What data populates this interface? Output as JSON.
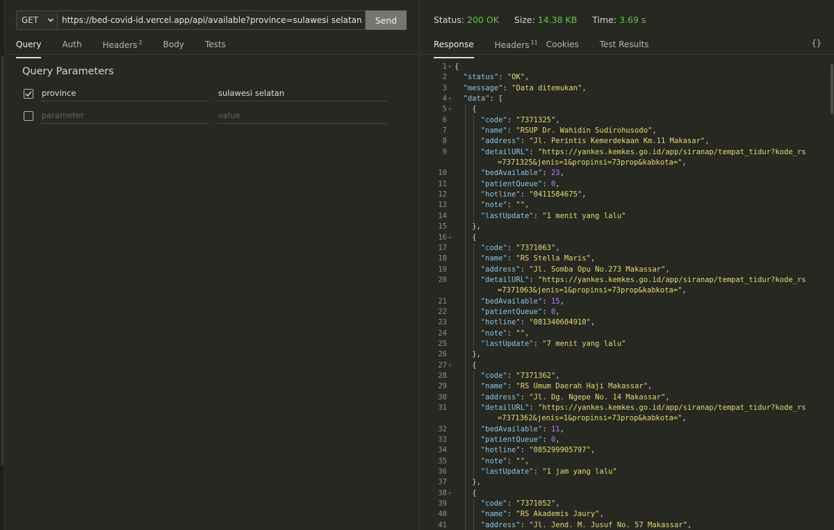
{
  "request": {
    "method": "GET",
    "url": "https://bed-covid-id.vercel.app/api/available?province=sulawesi selatan",
    "send_label": "Send"
  },
  "request_tabs": [
    {
      "label": "Query",
      "active": true
    },
    {
      "label": "Auth"
    },
    {
      "label": "Headers",
      "badge": "2"
    },
    {
      "label": "Body"
    },
    {
      "label": "Tests"
    }
  ],
  "query": {
    "title": "Query Parameters",
    "params": [
      {
        "checked": true,
        "name": "province",
        "value": "sulawesi selatan"
      }
    ],
    "new_param": {
      "name_placeholder": "parameter",
      "value_placeholder": "value"
    }
  },
  "response": {
    "status_label": "Status:",
    "status_value": "200 OK",
    "size_label": "Size:",
    "size_value": "14.38 KB",
    "time_label": "Time:",
    "time_value": "3.69 s",
    "tabs": [
      {
        "label": "Response",
        "active": true
      },
      {
        "label": "Headers",
        "badge": "11"
      },
      {
        "label": "Cookies"
      },
      {
        "label": "Test Results"
      }
    ],
    "braces": "{}"
  },
  "colors": {
    "background": "#272822",
    "status_ok": "#62c54b",
    "json_key": "#8fc4e6",
    "json_string": "#e6db74",
    "json_number": "#ae81ff"
  },
  "code_lines": [
    {
      "n": "1",
      "fold": true,
      "indent": 0,
      "t": [
        [
          "p",
          "{"
        ]
      ]
    },
    {
      "n": "2",
      "indent": 1,
      "t": [
        [
          "k",
          "\"status\""
        ],
        [
          "p",
          ": "
        ],
        [
          "s",
          "\"OK\""
        ],
        [
          "p",
          ","
        ]
      ]
    },
    {
      "n": "3",
      "indent": 1,
      "t": [
        [
          "k",
          "\"message\""
        ],
        [
          "p",
          ": "
        ],
        [
          "s",
          "\"Data ditemukan\""
        ],
        [
          "p",
          ","
        ]
      ]
    },
    {
      "n": "4",
      "fold": true,
      "indent": 1,
      "t": [
        [
          "k",
          "\"data\""
        ],
        [
          "p",
          ": ["
        ]
      ]
    },
    {
      "n": "5",
      "fold": true,
      "indent": 2,
      "t": [
        [
          "p",
          "{"
        ]
      ]
    },
    {
      "n": "6",
      "indent": 3,
      "t": [
        [
          "k",
          "\"code\""
        ],
        [
          "p",
          ": "
        ],
        [
          "s",
          "\"7371325\""
        ],
        [
          "p",
          ","
        ]
      ]
    },
    {
      "n": "7",
      "indent": 3,
      "t": [
        [
          "k",
          "\"name\""
        ],
        [
          "p",
          ": "
        ],
        [
          "s",
          "\"RSUP Dr. Wahidin Sudirohusodo\""
        ],
        [
          "p",
          ","
        ]
      ]
    },
    {
      "n": "8",
      "indent": 3,
      "t": [
        [
          "k",
          "\"address\""
        ],
        [
          "p",
          ": "
        ],
        [
          "s",
          "\"Jl. Perintis Kemerdekaan Km.11 Makasar\""
        ],
        [
          "p",
          ","
        ]
      ]
    },
    {
      "n": "9",
      "indent": 3,
      "t": [
        [
          "k",
          "\"detailURL\""
        ],
        [
          "p",
          ": "
        ],
        [
          "s",
          "\"https://yankes.kemkes.go.id/app/siranap/tempat_tidur?kode_rs"
        ]
      ]
    },
    {
      "n": "",
      "indent": 3,
      "wrap": true,
      "t": [
        [
          "s",
          "=7371325&jenis=1&propinsi=73prop&kabkota=\""
        ],
        [
          "p",
          ","
        ]
      ]
    },
    {
      "n": "10",
      "indent": 3,
      "t": [
        [
          "k",
          "\"bedAvailable\""
        ],
        [
          "p",
          ": "
        ],
        [
          "n",
          "23"
        ],
        [
          "p",
          ","
        ]
      ]
    },
    {
      "n": "11",
      "indent": 3,
      "t": [
        [
          "k",
          "\"patientQueue\""
        ],
        [
          "p",
          ": "
        ],
        [
          "n",
          "0"
        ],
        [
          "p",
          ","
        ]
      ]
    },
    {
      "n": "12",
      "indent": 3,
      "t": [
        [
          "k",
          "\"hotline\""
        ],
        [
          "p",
          ": "
        ],
        [
          "s",
          "\"0411584675\""
        ],
        [
          "p",
          ","
        ]
      ]
    },
    {
      "n": "13",
      "indent": 3,
      "t": [
        [
          "k",
          "\"note\""
        ],
        [
          "p",
          ": "
        ],
        [
          "s",
          "\"\""
        ],
        [
          "p",
          ","
        ]
      ]
    },
    {
      "n": "14",
      "indent": 3,
      "t": [
        [
          "k",
          "\"lastUpdate\""
        ],
        [
          "p",
          ": "
        ],
        [
          "s",
          "\"1 menit yang lalu\""
        ]
      ]
    },
    {
      "n": "15",
      "indent": 2,
      "t": [
        [
          "p",
          "},"
        ]
      ]
    },
    {
      "n": "16",
      "fold": true,
      "indent": 2,
      "t": [
        [
          "p",
          "{"
        ]
      ]
    },
    {
      "n": "17",
      "indent": 3,
      "t": [
        [
          "k",
          "\"code\""
        ],
        [
          "p",
          ": "
        ],
        [
          "s",
          "\"7371063\""
        ],
        [
          "p",
          ","
        ]
      ]
    },
    {
      "n": "18",
      "indent": 3,
      "t": [
        [
          "k",
          "\"name\""
        ],
        [
          "p",
          ": "
        ],
        [
          "s",
          "\"RS Stella Maris\""
        ],
        [
          "p",
          ","
        ]
      ]
    },
    {
      "n": "19",
      "indent": 3,
      "t": [
        [
          "k",
          "\"address\""
        ],
        [
          "p",
          ": "
        ],
        [
          "s",
          "\"Jl. Somba Opu No.273 Makassar\""
        ],
        [
          "p",
          ","
        ]
      ]
    },
    {
      "n": "20",
      "indent": 3,
      "t": [
        [
          "k",
          "\"detailURL\""
        ],
        [
          "p",
          ": "
        ],
        [
          "s",
          "\"https://yankes.kemkes.go.id/app/siranap/tempat_tidur?kode_rs"
        ]
      ]
    },
    {
      "n": "",
      "indent": 3,
      "wrap": true,
      "t": [
        [
          "s",
          "=7371063&jenis=1&propinsi=73prop&kabkota=\""
        ],
        [
          "p",
          ","
        ]
      ]
    },
    {
      "n": "21",
      "indent": 3,
      "t": [
        [
          "k",
          "\"bedAvailable\""
        ],
        [
          "p",
          ": "
        ],
        [
          "n",
          "15"
        ],
        [
          "p",
          ","
        ]
      ]
    },
    {
      "n": "22",
      "indent": 3,
      "t": [
        [
          "k",
          "\"patientQueue\""
        ],
        [
          "p",
          ": "
        ],
        [
          "n",
          "0"
        ],
        [
          "p",
          ","
        ]
      ]
    },
    {
      "n": "23",
      "indent": 3,
      "t": [
        [
          "k",
          "\"hotline\""
        ],
        [
          "p",
          ": "
        ],
        [
          "s",
          "\"081340604910\""
        ],
        [
          "p",
          ","
        ]
      ]
    },
    {
      "n": "24",
      "indent": 3,
      "t": [
        [
          "k",
          "\"note\""
        ],
        [
          "p",
          ": "
        ],
        [
          "s",
          "\"\""
        ],
        [
          "p",
          ","
        ]
      ]
    },
    {
      "n": "25",
      "indent": 3,
      "t": [
        [
          "k",
          "\"lastUpdate\""
        ],
        [
          "p",
          ": "
        ],
        [
          "s",
          "\"7 menit yang lalu\""
        ]
      ]
    },
    {
      "n": "26",
      "indent": 2,
      "t": [
        [
          "p",
          "},"
        ]
      ]
    },
    {
      "n": "27",
      "fold": true,
      "indent": 2,
      "t": [
        [
          "p",
          "{"
        ]
      ]
    },
    {
      "n": "28",
      "indent": 3,
      "t": [
        [
          "k",
          "\"code\""
        ],
        [
          "p",
          ": "
        ],
        [
          "s",
          "\"7371362\""
        ],
        [
          "p",
          ","
        ]
      ]
    },
    {
      "n": "29",
      "indent": 3,
      "t": [
        [
          "k",
          "\"name\""
        ],
        [
          "p",
          ": "
        ],
        [
          "s",
          "\"RS Umum Daerah Haji Makassar\""
        ],
        [
          "p",
          ","
        ]
      ]
    },
    {
      "n": "30",
      "indent": 3,
      "t": [
        [
          "k",
          "\"address\""
        ],
        [
          "p",
          ": "
        ],
        [
          "s",
          "\"Jl. Dg. Ngepe No. 14 Makassar\""
        ],
        [
          "p",
          ","
        ]
      ]
    },
    {
      "n": "31",
      "indent": 3,
      "t": [
        [
          "k",
          "\"detailURL\""
        ],
        [
          "p",
          ": "
        ],
        [
          "s",
          "\"https://yankes.kemkes.go.id/app/siranap/tempat_tidur?kode_rs"
        ]
      ]
    },
    {
      "n": "",
      "indent": 3,
      "wrap": true,
      "t": [
        [
          "s",
          "=7371362&jenis=1&propinsi=73prop&kabkota=\""
        ],
        [
          "p",
          ","
        ]
      ]
    },
    {
      "n": "32",
      "indent": 3,
      "t": [
        [
          "k",
          "\"bedAvailable\""
        ],
        [
          "p",
          ": "
        ],
        [
          "n",
          "11"
        ],
        [
          "p",
          ","
        ]
      ]
    },
    {
      "n": "33",
      "indent": 3,
      "t": [
        [
          "k",
          "\"patientQueue\""
        ],
        [
          "p",
          ": "
        ],
        [
          "n",
          "0"
        ],
        [
          "p",
          ","
        ]
      ]
    },
    {
      "n": "34",
      "indent": 3,
      "t": [
        [
          "k",
          "\"hotline\""
        ],
        [
          "p",
          ": "
        ],
        [
          "s",
          "\"085299905797\""
        ],
        [
          "p",
          ","
        ]
      ]
    },
    {
      "n": "35",
      "indent": 3,
      "t": [
        [
          "k",
          "\"note\""
        ],
        [
          "p",
          ": "
        ],
        [
          "s",
          "\"\""
        ],
        [
          "p",
          ","
        ]
      ]
    },
    {
      "n": "36",
      "indent": 3,
      "t": [
        [
          "k",
          "\"lastUpdate\""
        ],
        [
          "p",
          ": "
        ],
        [
          "s",
          "\"1 jam yang lalu\""
        ]
      ]
    },
    {
      "n": "37",
      "indent": 2,
      "t": [
        [
          "p",
          "},"
        ]
      ]
    },
    {
      "n": "38",
      "fold": true,
      "indent": 2,
      "t": [
        [
          "p",
          "{"
        ]
      ]
    },
    {
      "n": "39",
      "indent": 3,
      "t": [
        [
          "k",
          "\"code\""
        ],
        [
          "p",
          ": "
        ],
        [
          "s",
          "\"7371052\""
        ],
        [
          "p",
          ","
        ]
      ]
    },
    {
      "n": "40",
      "indent": 3,
      "t": [
        [
          "k",
          "\"name\""
        ],
        [
          "p",
          ": "
        ],
        [
          "s",
          "\"RS Akademis Jaury\""
        ],
        [
          "p",
          ","
        ]
      ]
    },
    {
      "n": "41",
      "indent": 3,
      "t": [
        [
          "k",
          "\"address\""
        ],
        [
          "p",
          ": "
        ],
        [
          "s",
          "\"Jl. Jend. M. Jusuf No. 57 Makassar\""
        ],
        [
          "p",
          ","
        ]
      ]
    }
  ]
}
